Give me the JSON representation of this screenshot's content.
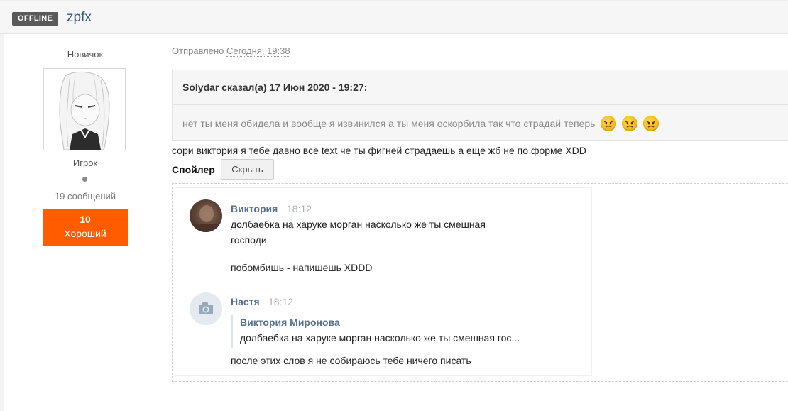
{
  "header": {
    "status_badge": "OFFLINE",
    "username": "zpfx"
  },
  "author": {
    "rank_title": "Новичок",
    "group": "Игрок",
    "post_count": "19 сообщений",
    "reputation_value": "10",
    "reputation_label": "Хороший",
    "reputation_color": "#ff5c00"
  },
  "post": {
    "sent_prefix": "Отправлено",
    "sent_time": "Сегодня, 19:38",
    "quote": {
      "citation": "Solydar сказал(а) 17 Июн 2020 - 19:27:",
      "text": "нет ты меня обидела и вообще я извинился а ты меня оскорбила так что страдай теперь",
      "emoji": [
        "angry-face-icon",
        "angry-face-icon",
        "angry-face-icon"
      ]
    },
    "reply": "сори виктория я тебе давно все text че ты фигней страдаешь а еще жб не по форме XDD",
    "spoiler": {
      "label": "Спойлер",
      "button": "Скрыть"
    }
  },
  "chat": {
    "messages": [
      {
        "author": "Виктория",
        "time": "18:12",
        "lines": [
          "долбаебка на харуке морган насколько же ты смешная",
          "господи",
          "побомбишь - напишешь XDDD"
        ]
      },
      {
        "author": "Настя",
        "time": "18:12",
        "forward_author": "Виктория Миронова",
        "forward_text": "долбаебка на харуке морган насколько же ты смешная гос...",
        "lines": [
          "после этих слов я не собираюсь тебе ничего писать"
        ]
      }
    ],
    "link_color": "#56708f"
  }
}
